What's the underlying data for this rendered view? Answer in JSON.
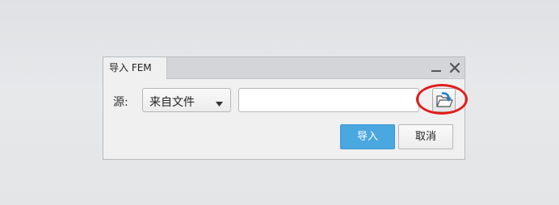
{
  "dialog": {
    "title": "导入 FEM",
    "controls": {
      "minimize_icon": "minimize-icon",
      "close_icon": "close-icon"
    },
    "source": {
      "label": "源:",
      "selected": "来自文件"
    },
    "path_input": {
      "value": "",
      "placeholder": ""
    },
    "browse_icon": "open-folder-icon",
    "buttons": {
      "import": "导入",
      "cancel": "取消"
    }
  },
  "colors": {
    "accent": "#4aa7e0",
    "highlight": "#e31b1b",
    "titlebar": "#d3d5d8"
  }
}
